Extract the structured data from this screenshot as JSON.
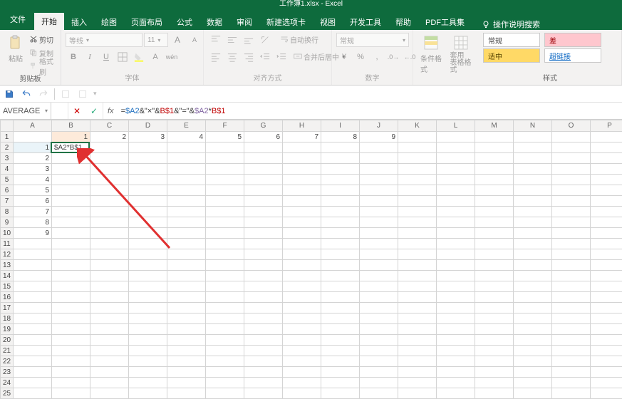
{
  "app": {
    "title": "工作簿1.xlsx  -  Excel"
  },
  "tabs": {
    "file": "文件",
    "home": "开始",
    "insert": "插入",
    "draw": "绘图",
    "layout": "页面布局",
    "formulas": "公式",
    "data": "数据",
    "review": "审阅",
    "newtab": "新建选项卡",
    "view": "视图",
    "dev": "开发工具",
    "help": "帮助",
    "pdf": "PDF工具集",
    "tell_me": "操作说明搜索"
  },
  "ribbon": {
    "clipboard": {
      "paste": "粘贴",
      "cut": "剪切",
      "copy": "复制",
      "format_painter": "格式刷",
      "label": "剪贴板"
    },
    "font": {
      "name": "等线",
      "size": "11",
      "b": "B",
      "i": "I",
      "u": "U",
      "label": "字体"
    },
    "align": {
      "wrap": "自动换行",
      "merge": "合并后居中",
      "label": "对齐方式"
    },
    "number": {
      "format": "常规",
      "label": "数字"
    },
    "styles": {
      "cond": "条件格式",
      "table": "套用\n表格格式",
      "normal": "常规",
      "bad": "差",
      "neutral": "适中",
      "link": "超链接",
      "label": "样式"
    }
  },
  "formula_bar": {
    "name_box": "AVERAGE",
    "formula_raw": "=$A2&\"×\"&B$1&\"=\"&$A2*B$1",
    "p0": "=",
    "p1": "$A2",
    "p2": "&\"×\"&",
    "p3": "B$1",
    "p4": "&\"=\"&",
    "p5": "$A2",
    "p6": "*",
    "p7": "B$1"
  },
  "grid": {
    "columns": [
      "A",
      "B",
      "C",
      "D",
      "E",
      "F",
      "G",
      "H",
      "I",
      "J",
      "K",
      "L",
      "M",
      "N",
      "O",
      "P"
    ],
    "row1": [
      "",
      "1",
      "2",
      "3",
      "4",
      "5",
      "6",
      "7",
      "8",
      "9",
      "",
      "",
      "",
      "",
      "",
      ""
    ],
    "colA_rows2to9": [
      "1",
      "2",
      "3",
      "4",
      "5",
      "6",
      "7",
      "8"
    ],
    "row10_A": "9",
    "editing_cell_display": "$A2*B$1",
    "row_headers": [
      "1",
      "2",
      "3",
      "4",
      "5",
      "6",
      "7",
      "8",
      "9",
      "10",
      "11",
      "12",
      "13",
      "14",
      "15",
      "16",
      "17",
      "18",
      "19",
      "20",
      "21",
      "22",
      "23",
      "24",
      "25"
    ]
  }
}
